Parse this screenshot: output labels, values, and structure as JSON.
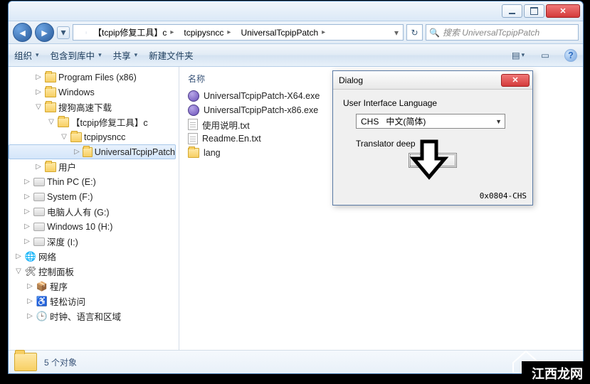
{
  "breadcrumb": {
    "seg1": "【tcpip修复工具】c",
    "seg2": "tcpipysncc",
    "seg3": "UniversalTcpipPatch"
  },
  "search": {
    "placeholder": "搜索 UniversalTcpipPatch"
  },
  "toolbar": {
    "organize": "组织",
    "include": "包含到库中",
    "share": "共享",
    "newfolder": "新建文件夹"
  },
  "tree": {
    "n_progfiles": "Program Files (x86)",
    "n_windows": "Windows",
    "n_sogou": "搜狗高速下载",
    "n_tcpiptool": "【tcpip修复工具】c",
    "n_tcpipysncc": "tcpipysncc",
    "n_universal": "UniversalTcpipPatch",
    "n_users": "用户",
    "n_thinpc": "Thin PC (E:)",
    "n_system": "System (F:)",
    "n_renren": "电脑人人有 (G:)",
    "n_win10": "Windows 10 (H:)",
    "n_shendu": "深度 (I:)",
    "n_network": "网络",
    "n_cpanel": "控制面板",
    "n_programs": "程序",
    "n_easy": "轻松访问",
    "n_clockregion": "时钟、语言和区域"
  },
  "content": {
    "header_name": "名称",
    "items": {
      "i0": "UniversalTcpipPatch-X64.exe",
      "i1": "UniversalTcpipPatch-x86.exe",
      "i2": "使用说明.txt",
      "i3": "Readme.En.txt",
      "i4": "lang"
    }
  },
  "status": {
    "count": "5 个对象"
  },
  "dialog": {
    "title": "Dialog",
    "label": "User Interface Language",
    "combo_code": "CHS",
    "combo_text": "中文(简体)",
    "translator": "Translator deep",
    "ok": "OK",
    "code": "0x0804-CHS"
  },
  "watermark": "江西龙网"
}
